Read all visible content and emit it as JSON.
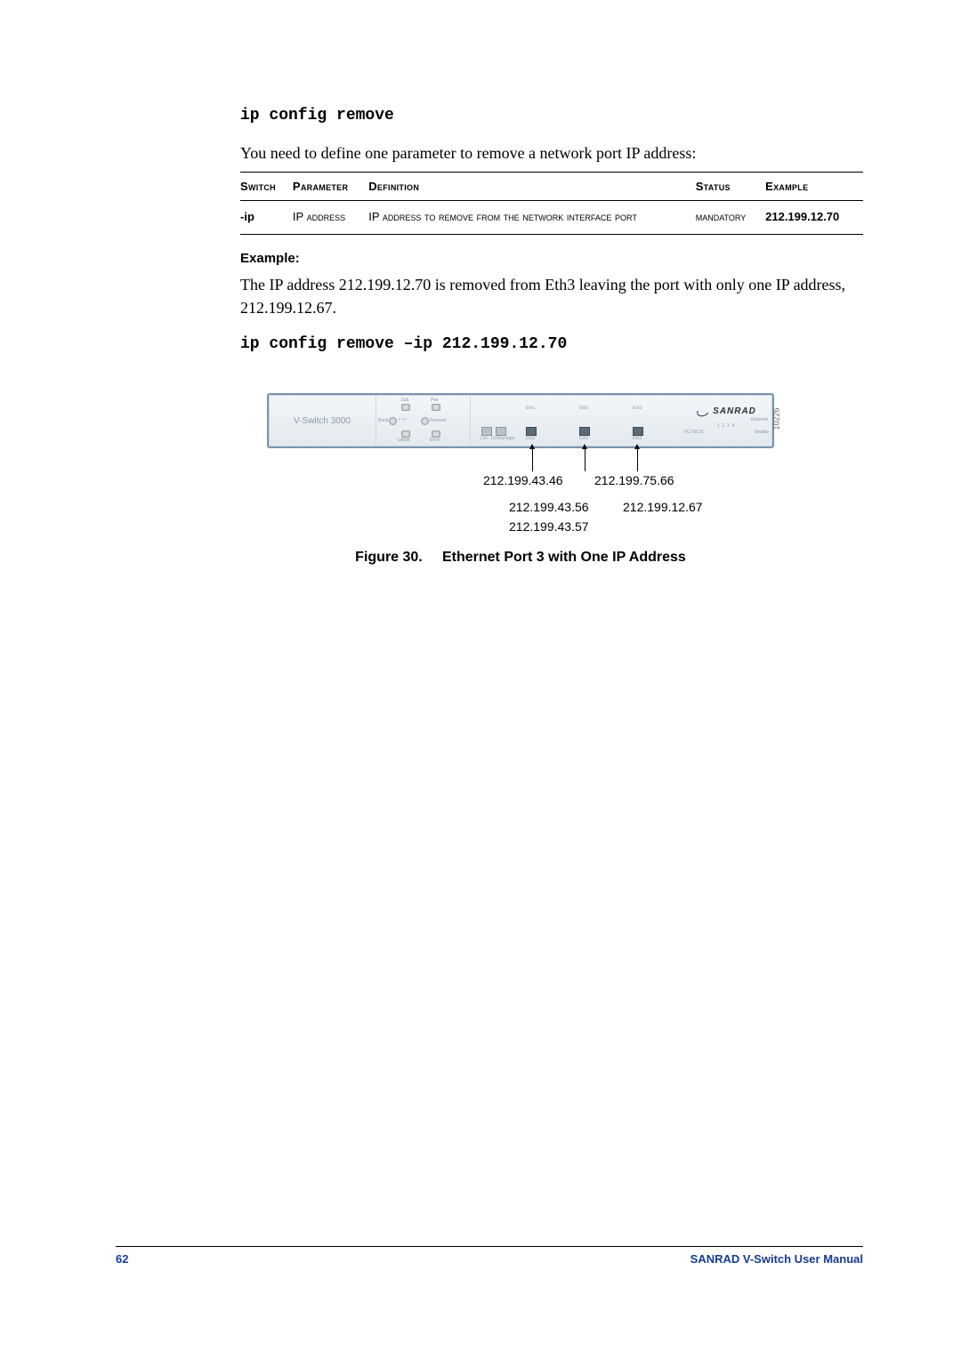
{
  "command": "ip config remove",
  "intro": "You need to define one parameter to remove a network port IP address:",
  "table": {
    "headers": {
      "switch": "Switch",
      "parameter": "Parameter",
      "definition": "Definition",
      "status": "Status",
      "example": "Example"
    },
    "row": {
      "switch": "-ip",
      "parameter": "IP address",
      "definition": "IP address to remove from the network interface port",
      "status": "mandatory",
      "example": "212.199.12.70"
    }
  },
  "example_heading": "Example:",
  "example_text": "The IP address 212.199.12.70 is removed from Eth3 leaving the port with only one IP address, 212.199.12.67.",
  "example_command": "ip config remove –ip 212.199.12.70",
  "figure": {
    "device_name": "V-Switch 3000",
    "brand": "SANRAD",
    "brand_sub1": "Ethernet",
    "brand_sub3": "Enable",
    "side_code": "10226",
    "port_section_labels": {
      "con": "Con",
      "mgmt": "1G/Manager",
      "eth1": "Eth1",
      "eth2": "Eth2",
      "eth3": "Eth3",
      "fc": "FC-ISCSI"
    },
    "leds": {
      "top1": "1Gb",
      "top2": "Pwr",
      "mid1": "Back",
      "mid2": "Forward",
      "row2_1": "Uplink",
      "row2_2": "Error"
    },
    "ips": {
      "eth1_top": "212.199.43.46",
      "eth2_top": "212.199.75.66",
      "eth1_mid": "212.199.43.56",
      "eth3_mid": "212.199.12.67",
      "eth1_bot": "212.199.43.57"
    },
    "caption_prefix": "Figure 30.",
    "caption_text": "Ethernet Port 3 with One IP Address"
  },
  "footer": {
    "page": "62",
    "manual": "SANRAD V-Switch User Manual"
  }
}
